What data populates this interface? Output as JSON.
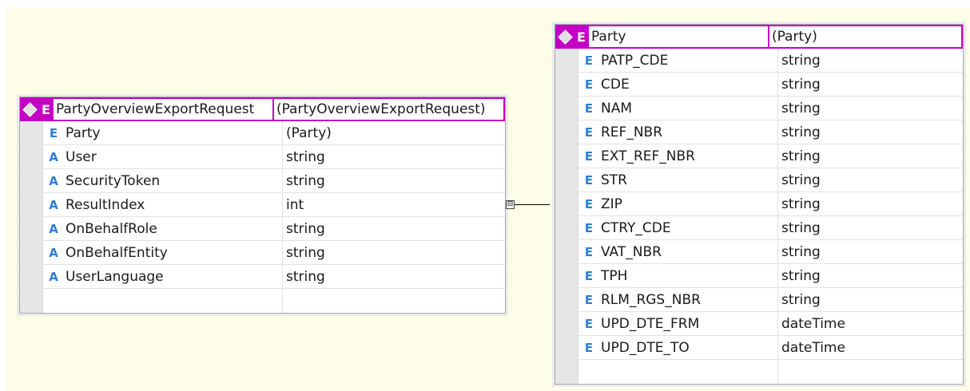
{
  "left_node": {
    "header": {
      "kind": "E",
      "name": "PartyOverviewExportRequest",
      "type": "(PartyOverviewExportRequest)"
    },
    "rows": [
      {
        "kind": "E",
        "name": "Party",
        "type": "(Party)"
      },
      {
        "kind": "A",
        "name": "User",
        "type": "string"
      },
      {
        "kind": "A",
        "name": "SecurityToken",
        "type": "string"
      },
      {
        "kind": "A",
        "name": "ResultIndex",
        "type": "int"
      },
      {
        "kind": "A",
        "name": "OnBehalfRole",
        "type": "string"
      },
      {
        "kind": "A",
        "name": "OnBehalfEntity",
        "type": "string"
      },
      {
        "kind": "A",
        "name": "UserLanguage",
        "type": "string"
      },
      {
        "kind": "",
        "name": "",
        "type": ""
      }
    ]
  },
  "connector": {
    "toggle_symbol": "⊟"
  },
  "right_node": {
    "header": {
      "kind": "E",
      "name": "Party",
      "type": "(Party)"
    },
    "rows": [
      {
        "kind": "E",
        "name": "PATP_CDE",
        "type": "string"
      },
      {
        "kind": "E",
        "name": "CDE",
        "type": "string"
      },
      {
        "kind": "E",
        "name": "NAM",
        "type": "string"
      },
      {
        "kind": "E",
        "name": "REF_NBR",
        "type": "string"
      },
      {
        "kind": "E",
        "name": "EXT_REF_NBR",
        "type": "string"
      },
      {
        "kind": "E",
        "name": "STR",
        "type": "string"
      },
      {
        "kind": "E",
        "name": "ZIP",
        "type": "string"
      },
      {
        "kind": "E",
        "name": "CTRY_CDE",
        "type": "string"
      },
      {
        "kind": "E",
        "name": "VAT_NBR",
        "type": "string"
      },
      {
        "kind": "E",
        "name": "TPH",
        "type": "string"
      },
      {
        "kind": "E",
        "name": "RLM_RGS_NBR",
        "type": "string"
      },
      {
        "kind": "E",
        "name": "UPD_DTE_FRM",
        "type": "dateTime"
      },
      {
        "kind": "E",
        "name": "UPD_DTE_TO",
        "type": "dateTime"
      },
      {
        "kind": "",
        "name": "",
        "type": ""
      }
    ]
  },
  "colors": {
    "header": "#c300c3",
    "kind_icon": "#2b7fd6",
    "canvas": "#fefee8"
  }
}
